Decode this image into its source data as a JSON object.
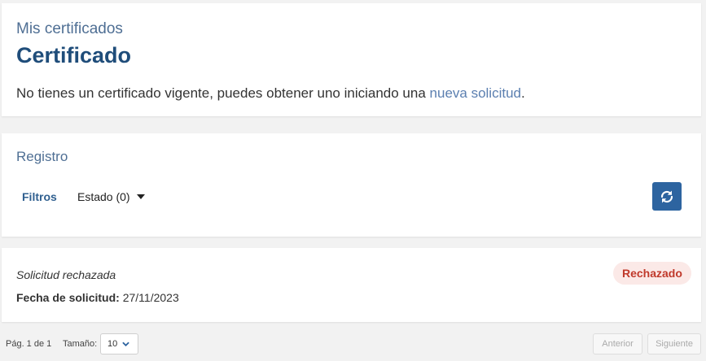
{
  "certificate": {
    "eyebrow": "Mis certificados",
    "title": "Certificado",
    "desc_prefix": "No tienes un certificado vigente, puedes obtener uno iniciando una ",
    "desc_link": "nueva solicitud",
    "desc_suffix": "."
  },
  "registro": {
    "eyebrow": "Registro",
    "filters_label": "Filtros",
    "estado_label": "Estado (0)",
    "refresh_icon": "refresh-icon",
    "accent_color": "#2d64a0"
  },
  "request": {
    "title": "Solicitud rechazada",
    "date_label": "Fecha de solicitud:",
    "date_value": "27/11/2023",
    "status": "Rechazado",
    "status_color": "#c0392b",
    "status_bg": "#fbe9e7"
  },
  "pagination": {
    "page_info": "Pág. 1 de 1",
    "size_label": "Tamaño:",
    "size_value": "10",
    "prev_label": "Anterior",
    "next_label": "Siguiente"
  }
}
